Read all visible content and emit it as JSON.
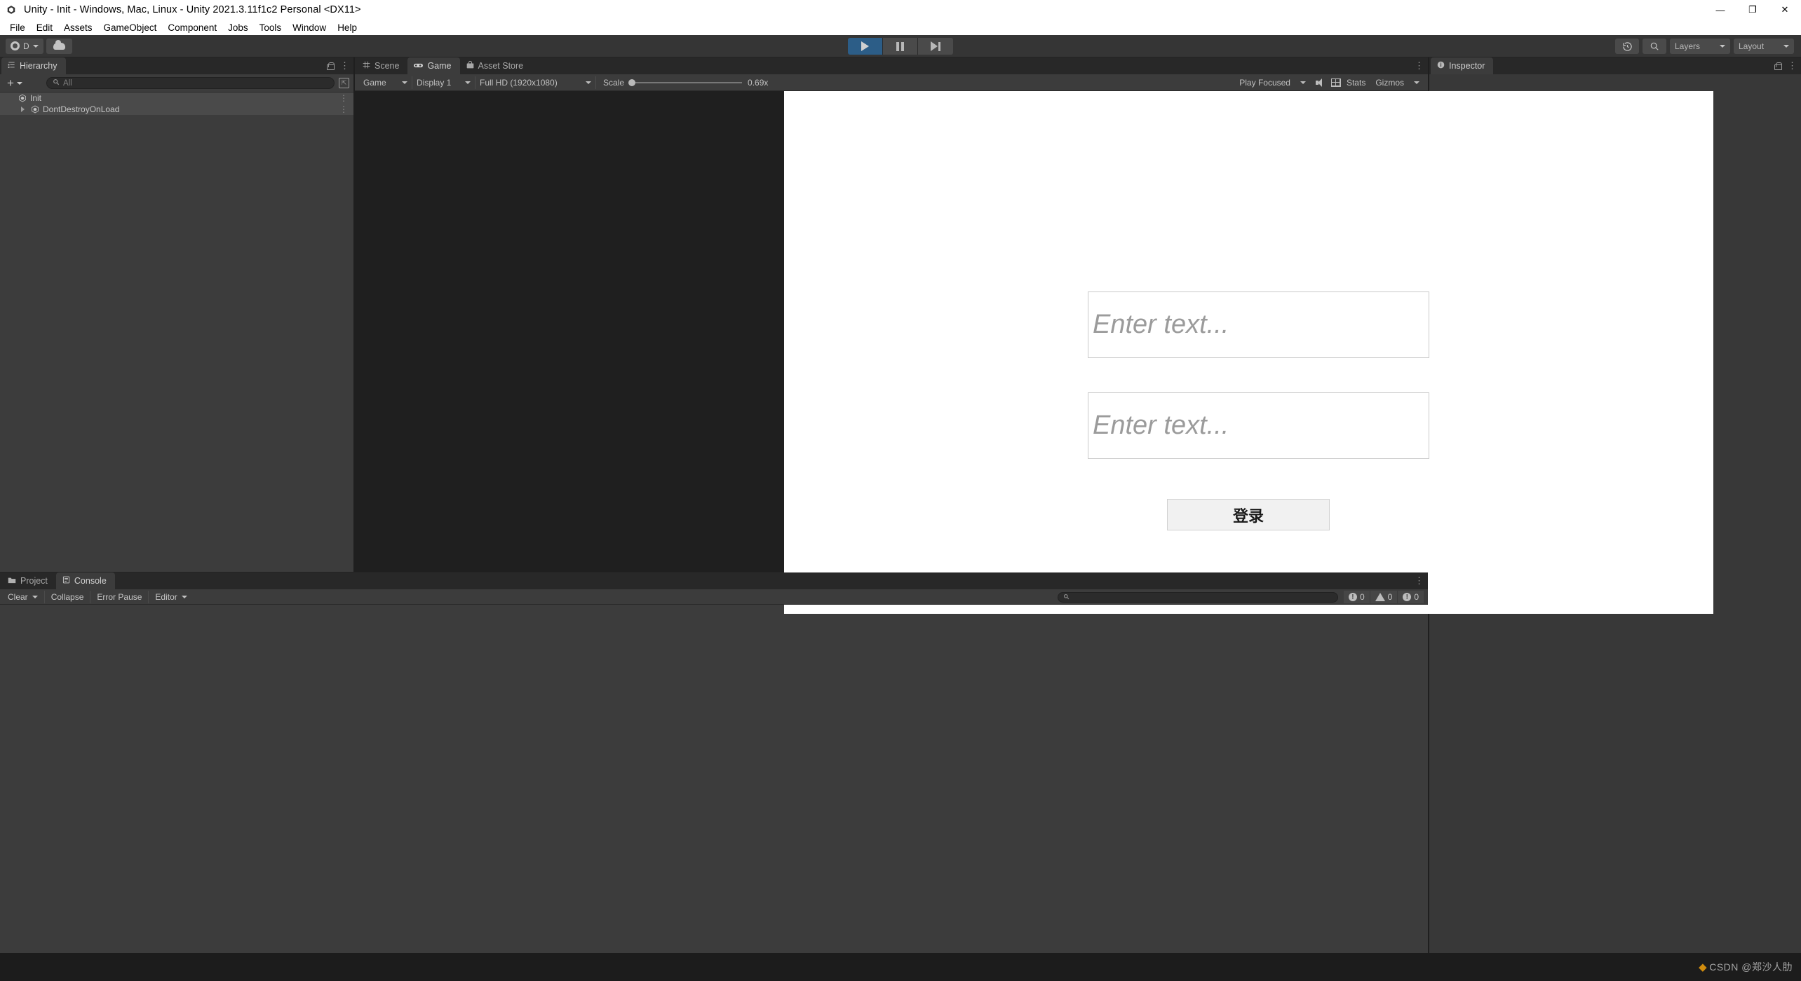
{
  "window": {
    "title": "Unity - Init - Windows, Mac, Linux - Unity 2021.3.11f1c2 Personal <DX11>",
    "logo_icon": "unity-logo-icon",
    "minimize_label": "—",
    "maximize_label": "❐",
    "close_label": "✕"
  },
  "menubar": {
    "items": [
      {
        "label": "File"
      },
      {
        "label": "Edit"
      },
      {
        "label": "Assets"
      },
      {
        "label": "GameObject"
      },
      {
        "label": "Component"
      },
      {
        "label": "Jobs"
      },
      {
        "label": "Tools"
      },
      {
        "label": "Window"
      },
      {
        "label": "Help"
      }
    ]
  },
  "toolbar": {
    "account_label": "D",
    "cloud_icon": "cloud-icon",
    "play_icon": "play-icon",
    "pause_icon": "pause-icon",
    "step_icon": "step-icon",
    "play_active": true,
    "history_icon": "history-icon",
    "search_icon": "search-icon",
    "layers_label": "Layers",
    "layout_label": "Layout"
  },
  "hierarchy": {
    "tab_label": "Hierarchy",
    "tab_icon": "hierarchy-icon",
    "add_label": "+",
    "search_placeholder": "All",
    "search_icon": "search-icon",
    "expand_icon": "expand-icon",
    "lock_icon": "lock-icon",
    "menu_icon": "kebab-menu-icon",
    "items": [
      {
        "label": "Init",
        "icon": "scene-icon",
        "selected": true,
        "expandable": false
      },
      {
        "label": "DontDestroyOnLoad",
        "icon": "scene-icon",
        "selected": true,
        "expandable": true
      }
    ]
  },
  "gameview": {
    "tabs": [
      {
        "label": "Scene",
        "icon": "grid-icon",
        "active": false
      },
      {
        "label": "Game",
        "icon": "gamepad-icon",
        "active": true
      },
      {
        "label": "Asset Store",
        "icon": "store-icon",
        "active": false
      }
    ],
    "menu_icon": "kebab-menu-icon",
    "controls": {
      "view_mode": "Game",
      "display": "Display 1",
      "resolution": "Full HD (1920x1080)",
      "scale_label": "Scale",
      "scale_value": "0.69x",
      "play_mode": "Play Focused",
      "mute_icon": "speaker-icon",
      "stats_icon": "stats-grid-icon",
      "stats_label": "Stats",
      "gizmos_label": "Gizmos"
    },
    "content": {
      "field1_placeholder": "Enter text...",
      "field2_placeholder": "Enter text...",
      "login_button_label": "登录"
    }
  },
  "inspector": {
    "tab_label": "Inspector",
    "tab_icon": "info-icon",
    "lock_icon": "lock-icon",
    "menu_icon": "kebab-menu-icon"
  },
  "bottom_panel": {
    "tabs": [
      {
        "label": "Project",
        "icon": "folder-icon",
        "active": false
      },
      {
        "label": "Console",
        "icon": "console-icon",
        "active": true
      }
    ],
    "menu_icon": "kebab-menu-icon",
    "console_toolbar": {
      "clear_label": "Clear",
      "collapse_label": "Collapse",
      "error_pause_label": "Error Pause",
      "editor_label": "Editor",
      "search_icon": "search-icon",
      "log_count": "0",
      "warning_count": "0",
      "error_count": "0"
    }
  },
  "statusbar": {
    "watermark": "CSDN @郑沙人肋"
  }
}
